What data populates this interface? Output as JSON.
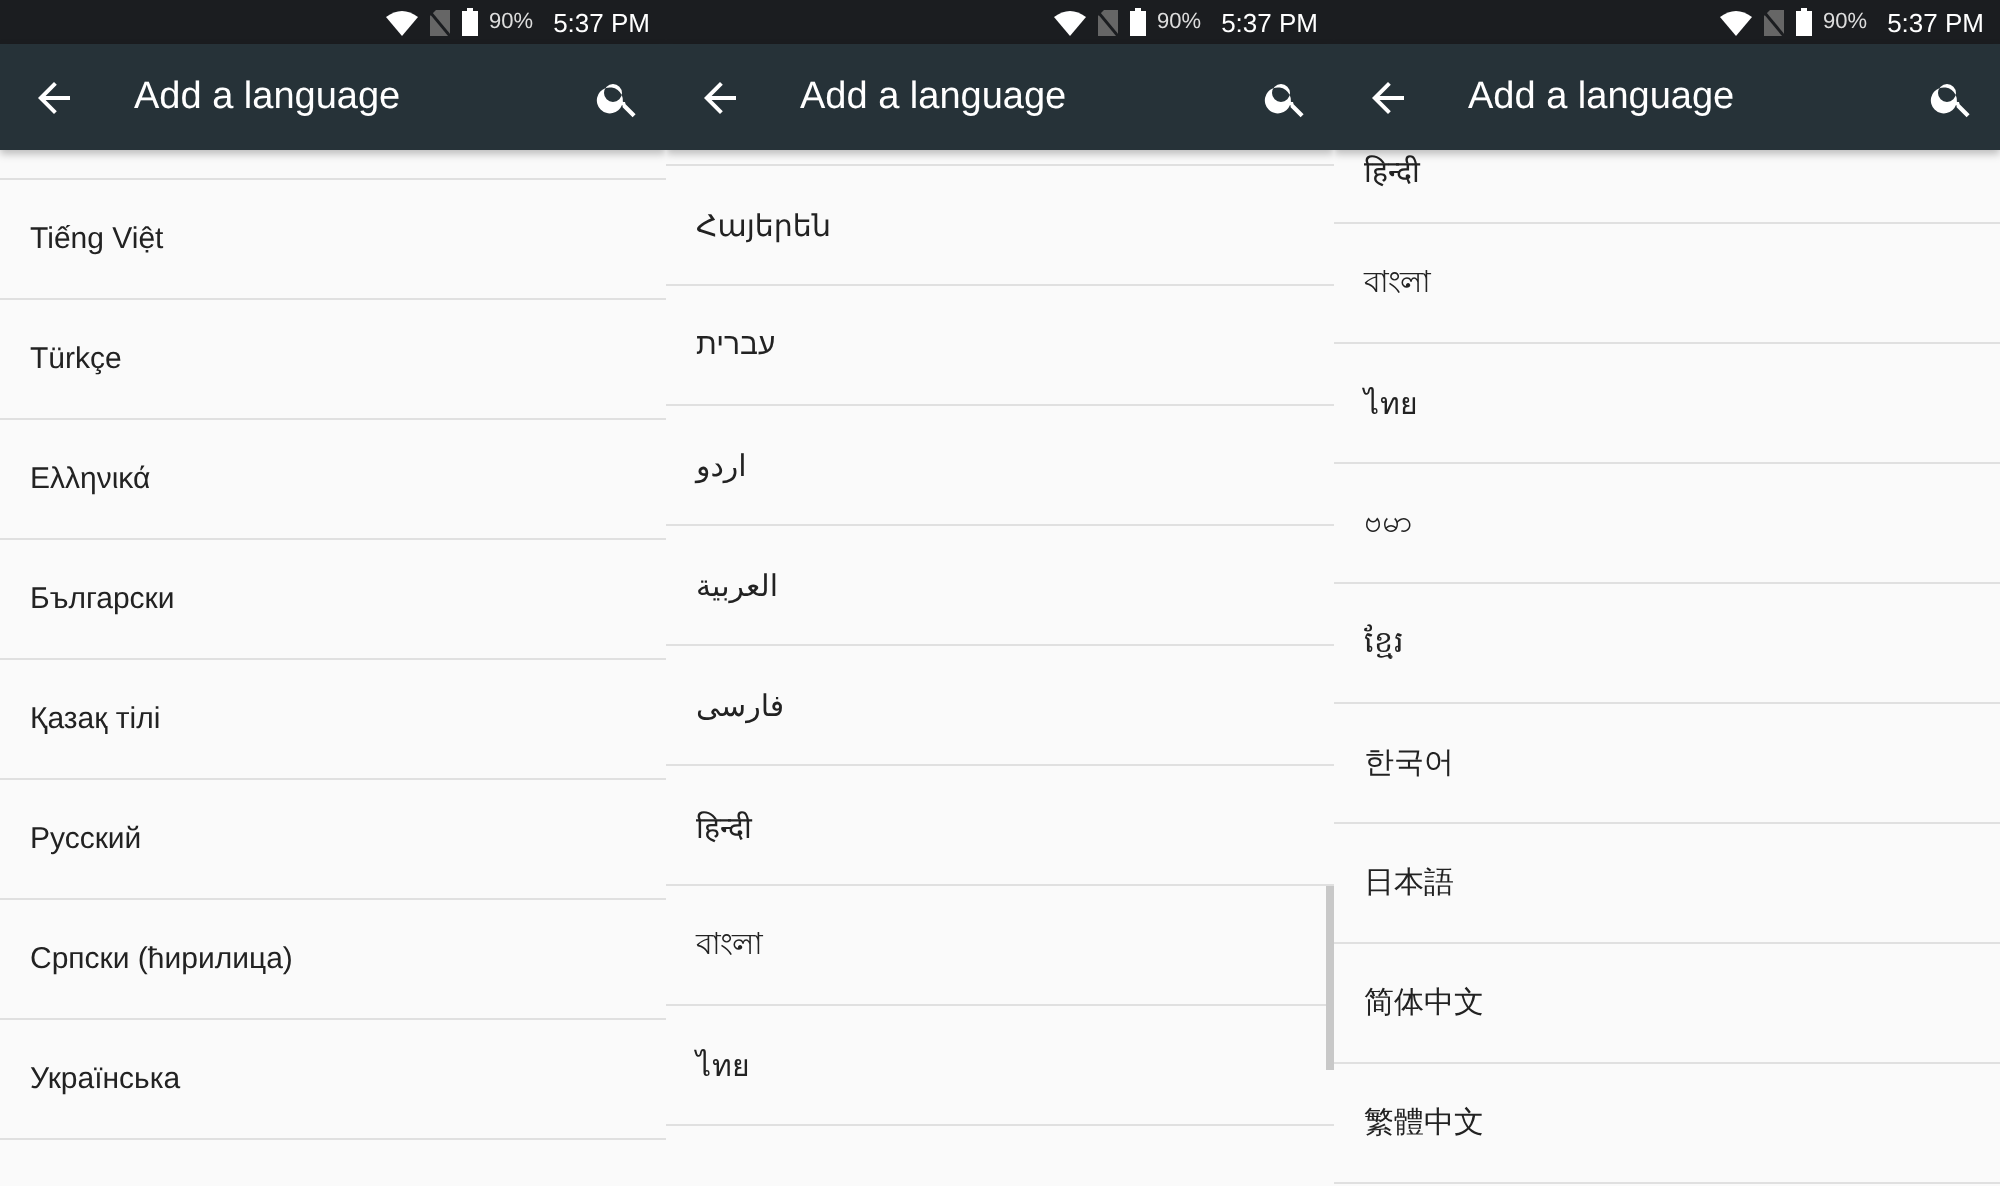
{
  "panels": [
    {
      "status_bar": {
        "battery": "90%",
        "time": "5:37 PM"
      },
      "toolbar": {
        "title": "Add a language"
      },
      "scrollbar_visible": false,
      "languages": [
        "Tiếng Việt",
        "Türkçe",
        "Ελληνικά",
        "Български",
        "Қазақ тілі",
        "Русский",
        "Српски (ћирилица)",
        "Українська"
      ]
    },
    {
      "status_bar": {
        "battery": "90%",
        "time": "5:37 PM"
      },
      "toolbar": {
        "title": "Add a language"
      },
      "scrollbar_visible": true,
      "languages": [
        "Հայերեն",
        "עברית",
        "اردو",
        "العربية",
        "فارسی",
        "हिन्दी",
        "বাংলা",
        "ไทย"
      ]
    },
    {
      "status_bar": {
        "battery": "90%",
        "time": "5:37 PM"
      },
      "toolbar": {
        "title": "Add a language"
      },
      "scrollbar_visible": false,
      "languages": [
        "हिन्दी",
        "বাংলা",
        "ไทย",
        "ဗမာ",
        "ខ្មែរ",
        "한국어",
        "日本語",
        "简体中文",
        "繁體中文"
      ]
    }
  ]
}
